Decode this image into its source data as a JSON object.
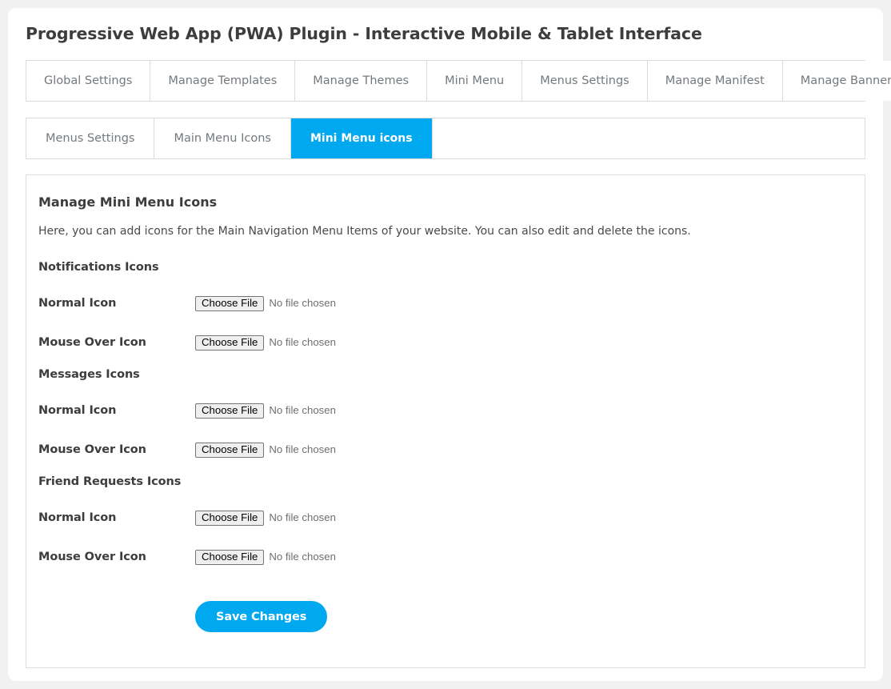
{
  "page": {
    "title": "Progressive Web App (PWA) Plugin - Interactive Mobile & Tablet Interface",
    "background_color": "#f1f1f1",
    "card_color": "#ffffff"
  },
  "colors": {
    "accent": "#00a8ef",
    "border": "#dddddd",
    "text_dark": "#3d3d3d",
    "text_muted": "#74797d"
  },
  "primary_tabs": [
    {
      "label": "Global Settings",
      "active": false
    },
    {
      "label": "Manage Templates",
      "active": false
    },
    {
      "label": "Manage Themes",
      "active": false
    },
    {
      "label": "Mini Menu",
      "active": false
    },
    {
      "label": "Menus Settings",
      "active": false
    },
    {
      "label": "Manage Manifest",
      "active": false
    },
    {
      "label": "Manage Banners",
      "active": false
    }
  ],
  "secondary_tabs": [
    {
      "label": "Menus Settings",
      "active": false
    },
    {
      "label": "Main Menu Icons",
      "active": false
    },
    {
      "label": "Mini Menu icons",
      "active": true
    }
  ],
  "panel": {
    "heading": "Manage Mini Menu Icons",
    "description": "Here, you can add icons for the Main Navigation Menu Items of your website. You can also edit and delete the icons.",
    "groups": [
      {
        "title": "Notifications Icons",
        "fields": [
          {
            "label": "Normal Icon",
            "button_label": "Choose File",
            "status": "No file chosen"
          },
          {
            "label": "Mouse Over Icon",
            "button_label": "Choose File",
            "status": "No file chosen"
          }
        ]
      },
      {
        "title": "Messages Icons",
        "fields": [
          {
            "label": "Normal Icon",
            "button_label": "Choose File",
            "status": "No file chosen"
          },
          {
            "label": "Mouse Over Icon",
            "button_label": "Choose File",
            "status": "No file chosen"
          }
        ]
      },
      {
        "title": "Friend Requests Icons",
        "fields": [
          {
            "label": "Normal Icon",
            "button_label": "Choose File",
            "status": "No file chosen"
          },
          {
            "label": "Mouse Over Icon",
            "button_label": "Choose File",
            "status": "No file chosen"
          }
        ]
      }
    ],
    "save_label": "Save Changes"
  }
}
